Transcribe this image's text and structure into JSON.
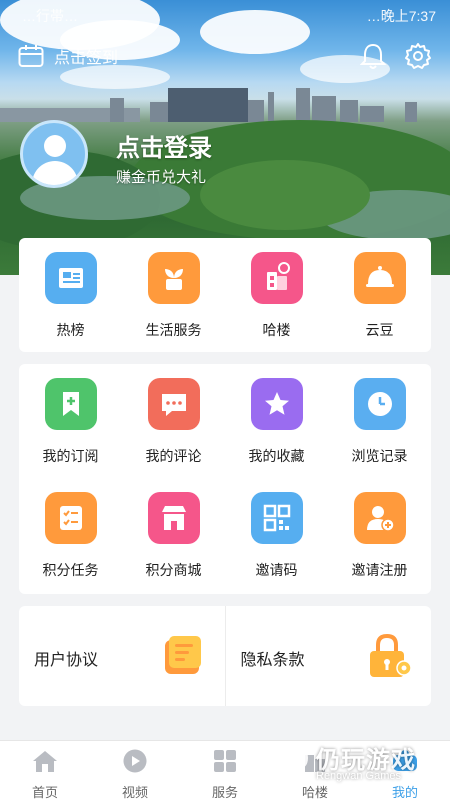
{
  "status_bar": {
    "left": "…行帯…",
    "right": "…晚上7:37"
  },
  "header": {
    "checkin_label": "点击签到",
    "login_title": "点击登录",
    "login_subtitle": "赚金币兑大礼",
    "icons": [
      "calendar-icon",
      "bell-icon",
      "settings-gear-icon"
    ]
  },
  "quick_grid": [
    {
      "label": "热榜",
      "icon": "hot-list-icon",
      "color": "#56aef0"
    },
    {
      "label": "生活服务",
      "icon": "life-service-icon",
      "color": "#ff9a3c"
    },
    {
      "label": "哈楼",
      "icon": "ha-lou-icon",
      "color": "#f5568a"
    },
    {
      "label": "云豆",
      "icon": "cloud-bean-icon",
      "color": "#ff9a3c"
    }
  ],
  "my_grid": [
    {
      "label": "我的订阅",
      "icon": "subscribe-icon",
      "color": "#4fc46b"
    },
    {
      "label": "我的评论",
      "icon": "comment-icon",
      "color": "#f26d5b"
    },
    {
      "label": "我的收藏",
      "icon": "favorite-star-icon",
      "color": "#9a6cf0"
    },
    {
      "label": "浏览记录",
      "icon": "history-clock-icon",
      "color": "#5aaef0"
    },
    {
      "label": "积分任务",
      "icon": "points-task-icon",
      "color": "#ff9a3c"
    },
    {
      "label": "积分商城",
      "icon": "points-mall-icon",
      "color": "#f5568a"
    },
    {
      "label": "邀请码",
      "icon": "qr-code-icon",
      "color": "#56aef0"
    },
    {
      "label": "邀请注册",
      "icon": "invite-user-icon",
      "color": "#ff9a3c"
    }
  ],
  "legal": {
    "user_agreement": "用户协议",
    "privacy_policy": "隐私条款"
  },
  "bottom_nav": [
    {
      "label": "首页",
      "icon": "home-icon",
      "active": false
    },
    {
      "label": "视频",
      "icon": "video-play-icon",
      "active": false
    },
    {
      "label": "服务",
      "icon": "services-grid-icon",
      "active": false
    },
    {
      "label": "哈楼",
      "icon": "ha-lou-tab-icon",
      "active": false
    },
    {
      "label": "我的",
      "icon": "profile-tab-icon",
      "active": true
    }
  ],
  "watermark": {
    "text": "仍玩游戏",
    "subtext": "Rengwan Games"
  },
  "colors": {
    "accent": "#3da0e8",
    "page_bg": "#f2f3f5"
  }
}
